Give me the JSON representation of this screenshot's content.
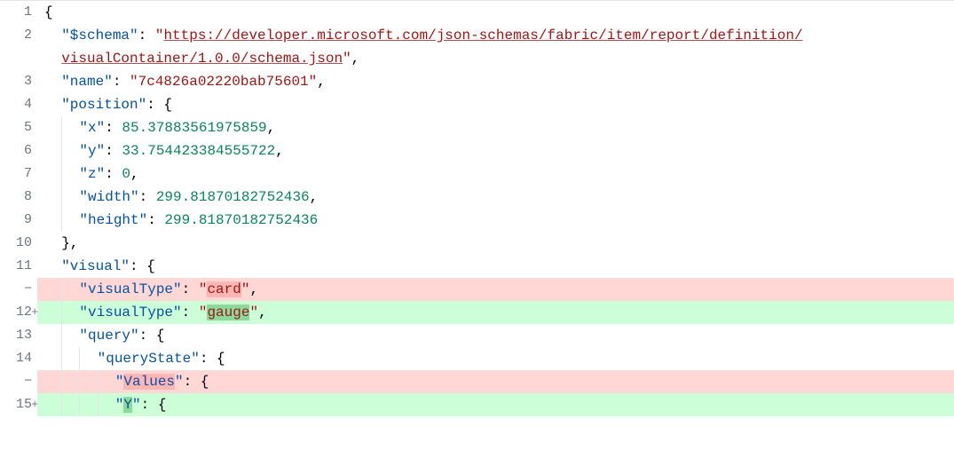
{
  "lines": [
    {
      "num": "1",
      "type": "ctx",
      "gutterMark": "",
      "indent": 0,
      "tokens": [
        {
          "t": "{",
          "c": "punc"
        }
      ]
    },
    {
      "num": "2",
      "type": "ctx",
      "gutterMark": "",
      "indent": 1,
      "tokens": [
        {
          "t": "\"$schema\"",
          "c": "key"
        },
        {
          "t": ": ",
          "c": "punc"
        },
        {
          "t": "\"",
          "c": "string"
        },
        {
          "t": "https://developer.microsoft.com/json-schemas/fabric/item/report/definition/",
          "c": "url"
        }
      ]
    },
    {
      "num": "",
      "type": "ctx",
      "gutterMark": "",
      "indent": 1,
      "tokens": [
        {
          "t": "visualContainer/1.0.0/schema.json",
          "c": "url"
        },
        {
          "t": "\"",
          "c": "string"
        },
        {
          "t": ",",
          "c": "punc"
        }
      ]
    },
    {
      "num": "3",
      "type": "ctx",
      "gutterMark": "",
      "indent": 1,
      "tokens": [
        {
          "t": "\"name\"",
          "c": "key"
        },
        {
          "t": ": ",
          "c": "punc"
        },
        {
          "t": "\"7c4826a02220bab75601\"",
          "c": "string"
        },
        {
          "t": ",",
          "c": "punc"
        }
      ]
    },
    {
      "num": "4",
      "type": "ctx",
      "gutterMark": "",
      "indent": 1,
      "tokens": [
        {
          "t": "\"position\"",
          "c": "key"
        },
        {
          "t": ": ",
          "c": "punc"
        },
        {
          "t": "{",
          "c": "punc"
        }
      ]
    },
    {
      "num": "5",
      "type": "ctx",
      "gutterMark": "",
      "indent": 2,
      "tokens": [
        {
          "t": "\"x\"",
          "c": "key"
        },
        {
          "t": ": ",
          "c": "punc"
        },
        {
          "t": "85.37883561975859",
          "c": "num"
        },
        {
          "t": ",",
          "c": "punc"
        }
      ]
    },
    {
      "num": "6",
      "type": "ctx",
      "gutterMark": "",
      "indent": 2,
      "tokens": [
        {
          "t": "\"y\"",
          "c": "key"
        },
        {
          "t": ": ",
          "c": "punc"
        },
        {
          "t": "33.754423384555722",
          "c": "num"
        },
        {
          "t": ",",
          "c": "punc"
        }
      ]
    },
    {
      "num": "7",
      "type": "ctx",
      "gutterMark": "",
      "indent": 2,
      "tokens": [
        {
          "t": "\"z\"",
          "c": "key"
        },
        {
          "t": ": ",
          "c": "punc"
        },
        {
          "t": "0",
          "c": "num"
        },
        {
          "t": ",",
          "c": "punc"
        }
      ]
    },
    {
      "num": "8",
      "type": "ctx",
      "gutterMark": "",
      "indent": 2,
      "tokens": [
        {
          "t": "\"width\"",
          "c": "key"
        },
        {
          "t": ": ",
          "c": "punc"
        },
        {
          "t": "299.81870182752436",
          "c": "num"
        },
        {
          "t": ",",
          "c": "punc"
        }
      ]
    },
    {
      "num": "9",
      "type": "ctx",
      "gutterMark": "",
      "indent": 2,
      "tokens": [
        {
          "t": "\"height\"",
          "c": "key"
        },
        {
          "t": ": ",
          "c": "punc"
        },
        {
          "t": "299.81870182752436",
          "c": "num"
        }
      ]
    },
    {
      "num": "10",
      "type": "ctx",
      "gutterMark": "",
      "indent": 1,
      "tokens": [
        {
          "t": "},",
          "c": "punc"
        }
      ]
    },
    {
      "num": "11",
      "type": "ctx",
      "gutterMark": "",
      "indent": 1,
      "tokens": [
        {
          "t": "\"visual\"",
          "c": "key"
        },
        {
          "t": ": ",
          "c": "punc"
        },
        {
          "t": "{",
          "c": "punc"
        }
      ]
    },
    {
      "num": "−",
      "type": "removed",
      "gutterMark": "minus",
      "indent": 2,
      "tokens": [
        {
          "t": "\"visualType\"",
          "c": "key"
        },
        {
          "t": ": ",
          "c": "punc"
        },
        {
          "t": "\"",
          "c": "string"
        },
        {
          "t": "card",
          "c": "string",
          "w": "removed"
        },
        {
          "t": "\"",
          "c": "string"
        },
        {
          "t": ",",
          "c": "punc"
        }
      ]
    },
    {
      "num": "12",
      "type": "added",
      "gutterMark": "plus",
      "indent": 2,
      "tokens": [
        {
          "t": "\"visualType\"",
          "c": "key"
        },
        {
          "t": ": ",
          "c": "punc"
        },
        {
          "t": "\"",
          "c": "string"
        },
        {
          "t": "gauge",
          "c": "string",
          "w": "added"
        },
        {
          "t": "\"",
          "c": "string"
        },
        {
          "t": ",",
          "c": "punc"
        }
      ]
    },
    {
      "num": "13",
      "type": "ctx",
      "gutterMark": "",
      "indent": 2,
      "tokens": [
        {
          "t": "\"query\"",
          "c": "key"
        },
        {
          "t": ": ",
          "c": "punc"
        },
        {
          "t": "{",
          "c": "punc"
        }
      ]
    },
    {
      "num": "14",
      "type": "ctx",
      "gutterMark": "",
      "indent": 3,
      "tokens": [
        {
          "t": "\"queryState\"",
          "c": "key"
        },
        {
          "t": ": ",
          "c": "punc"
        },
        {
          "t": "{",
          "c": "punc"
        }
      ]
    },
    {
      "num": "−",
      "type": "removed",
      "gutterMark": "minus",
      "indent": 4,
      "tokens": [
        {
          "t": "\"",
          "c": "key"
        },
        {
          "t": "Values",
          "c": "key",
          "w": "removed"
        },
        {
          "t": "\"",
          "c": "key"
        },
        {
          "t": ": ",
          "c": "punc"
        },
        {
          "t": "{",
          "c": "punc"
        }
      ]
    },
    {
      "num": "15",
      "type": "added",
      "gutterMark": "plus",
      "indent": 4,
      "tokens": [
        {
          "t": "\"",
          "c": "key"
        },
        {
          "t": "Y",
          "c": "key",
          "w": "added"
        },
        {
          "t": "\"",
          "c": "key"
        },
        {
          "t": ": ",
          "c": "punc"
        },
        {
          "t": "{",
          "c": "punc"
        }
      ]
    }
  ],
  "colors": {
    "removed_bg": "#ffd7d5",
    "added_bg": "#ccffd8",
    "word_removed": "#ff818266",
    "word_added": "#2ea04366"
  }
}
